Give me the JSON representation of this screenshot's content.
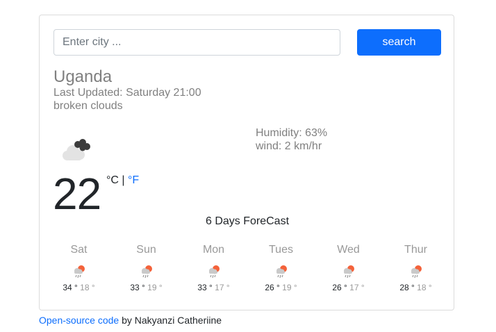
{
  "search": {
    "placeholder": "Enter city ...",
    "button_label": "search"
  },
  "current": {
    "city": "Uganda",
    "last_updated": "Last Updated: Saturday 21:00",
    "description": "broken clouds",
    "icon": "broken-clouds-icon",
    "humidity": "Humidity: 63%",
    "wind": "wind: 2 km/hr",
    "temperature": "22",
    "unit_celsius": "°C",
    "unit_separator": "|",
    "unit_fahrenheit": "°F"
  },
  "forecast": {
    "title": "6 Days ForeCast",
    "days": [
      {
        "name": "Sat",
        "max": "34 °",
        "min": "18 °",
        "icon": "rain-icon"
      },
      {
        "name": "Sun",
        "max": "33 °",
        "min": "19 °",
        "icon": "rain-icon"
      },
      {
        "name": "Mon",
        "max": "33 °",
        "min": "17 °",
        "icon": "rain-icon"
      },
      {
        "name": "Tues",
        "max": "26 °",
        "min": "19 °",
        "icon": "rain-icon"
      },
      {
        "name": "Wed",
        "max": "26 °",
        "min": "17 °",
        "icon": "rain-icon"
      },
      {
        "name": "Thur",
        "max": "28 °",
        "min": "18 °",
        "icon": "rain-icon"
      }
    ]
  },
  "footer": {
    "link_text": "Open-source code",
    "text": "by Nakyanzi Catheriine"
  },
  "colors": {
    "accent": "#0d6efd",
    "muted": "#808080",
    "border": "#dcdcdc"
  }
}
